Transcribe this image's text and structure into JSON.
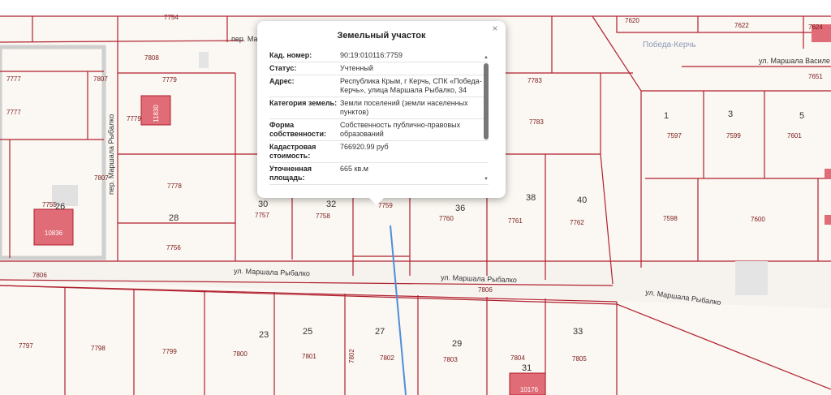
{
  "map": {
    "streets": [
      "пер. Маршала Рыбалко",
      "пер. Маршала Рыбалко",
      "ул. Маршала Рыбалко",
      "ул. Маршала Рыбалко",
      "ул. Маршала Рыбалко",
      "ул. Маршала Василе"
    ],
    "district": "Победа-Керчь",
    "parcel_ids": [
      "7754",
      "7808",
      "7777",
      "7807",
      "7779",
      "7777",
      "7779",
      "7807",
      "7778",
      "7755",
      "28",
      "7756",
      "30",
      "7757",
      "32",
      "7758",
      "7759",
      "7760",
      "36",
      "7761",
      "38",
      "40",
      "7762",
      "7783",
      "7783",
      "7620",
      "7622",
      "7624",
      "7651",
      "1",
      "3",
      "5",
      "7597",
      "7599",
      "7601",
      "7598",
      "7600",
      "7806",
      "7806",
      "7797",
      "7798",
      "7799",
      "7800",
      "23",
      "7801",
      "25",
      "7802",
      "27",
      "7802",
      "29",
      "7803",
      "7804",
      "31",
      "33",
      "7805",
      "26"
    ],
    "building_ids": [
      "11830",
      "10836",
      "10176"
    ]
  },
  "popup": {
    "title": "Земельный участок",
    "close": "×",
    "rows": [
      {
        "key": "Кад. номер:",
        "value": "90:19:010116:7759"
      },
      {
        "key": "Статус:",
        "value": "Учтенный"
      },
      {
        "key": "Адрес:",
        "value": "Республика Крым, г Керчь, СПК «Победа-Керчь», улица Маршала Рыбалко, 34"
      },
      {
        "key": "Категория земель:",
        "value": "Земли поселений (земли населенных пунктов)"
      },
      {
        "key": "Форма собственности:",
        "value": "Собственность публично-правовых образований"
      },
      {
        "key": "Кадастровая стоимость:",
        "value": "766920.99 руб"
      },
      {
        "key": "Уточненная площадь:",
        "value": "665 кв.м"
      }
    ]
  }
}
